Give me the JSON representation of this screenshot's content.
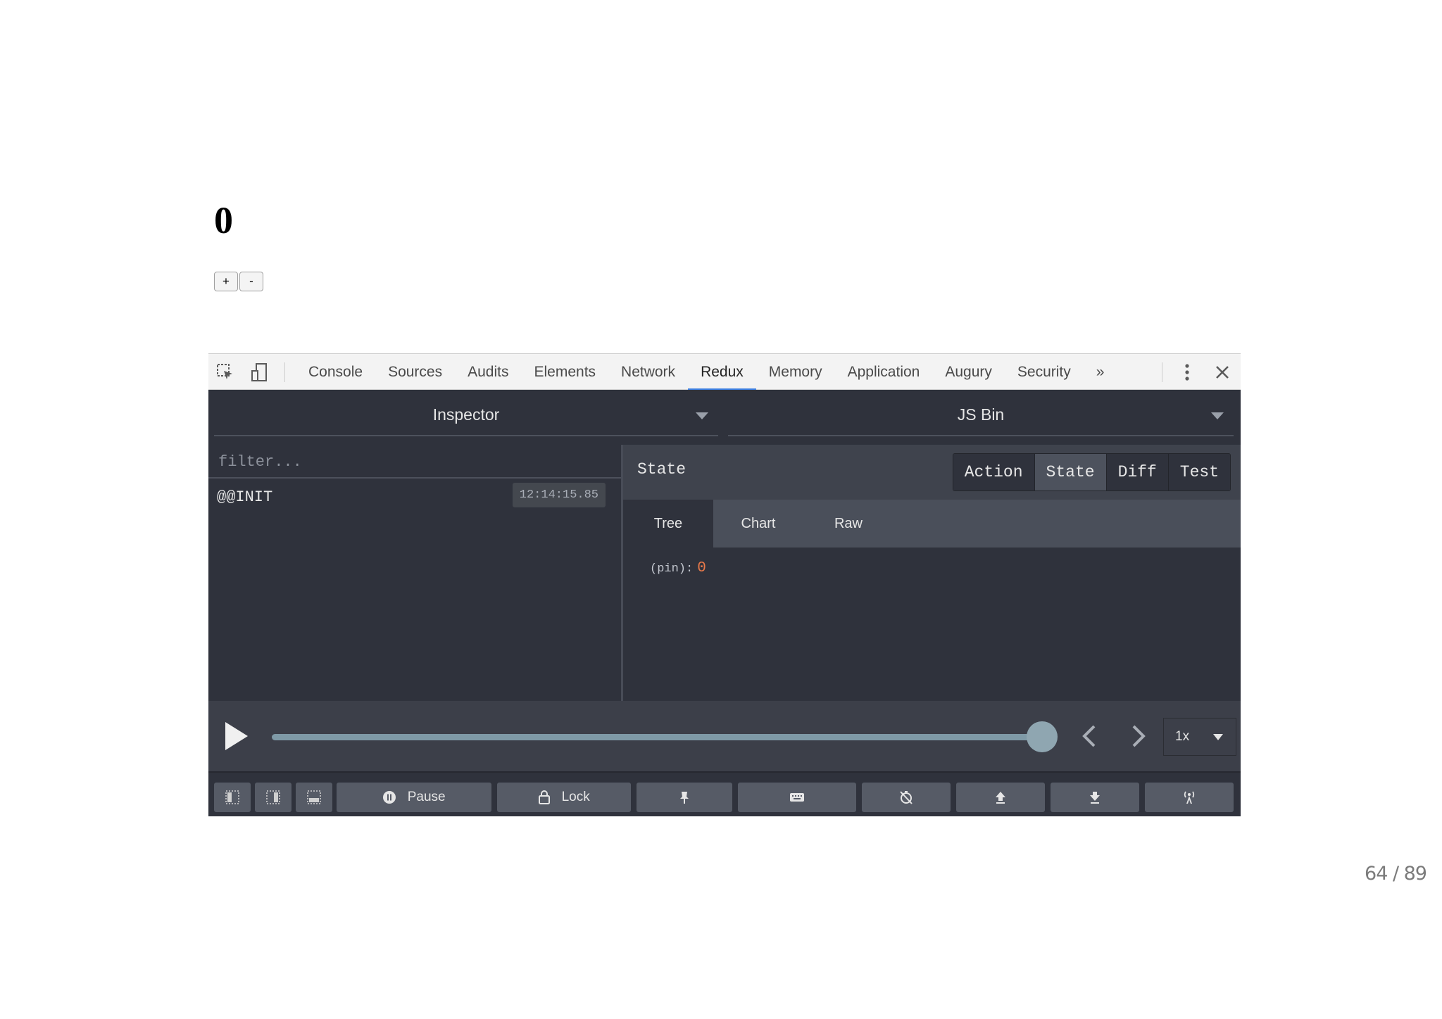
{
  "app": {
    "counter_value": "0",
    "increment_label": "+",
    "decrement_label": "-"
  },
  "devtools": {
    "tabs": [
      "Console",
      "Sources",
      "Audits",
      "Elements",
      "Network",
      "Redux",
      "Memory",
      "Application",
      "Augury",
      "Security"
    ],
    "active_tab": "Redux",
    "more_tabs_glyph": "»",
    "monitor_select": "Inspector",
    "instance_select": "JS Bin",
    "filter_placeholder": "filter...",
    "actions": [
      {
        "name": "@@INIT",
        "time": "12:14:15.85"
      }
    ],
    "state_title": "State",
    "segments": [
      "Action",
      "State",
      "Diff",
      "Test"
    ],
    "active_segment": "State",
    "subtabs": [
      "Tree",
      "Chart",
      "Raw"
    ],
    "active_subtab": "Tree",
    "tree": {
      "key": "(pin):",
      "value": "0"
    },
    "slider": {
      "position": 1.0,
      "speed": "1x"
    },
    "buttons": {
      "pause": "Pause",
      "lock": "Lock"
    },
    "colors": {
      "panel_bg": "#2f323c",
      "active_tab_underline": "#3b7de0",
      "number_value": "#e8794a"
    }
  },
  "slide": {
    "page": "64 / 89"
  }
}
